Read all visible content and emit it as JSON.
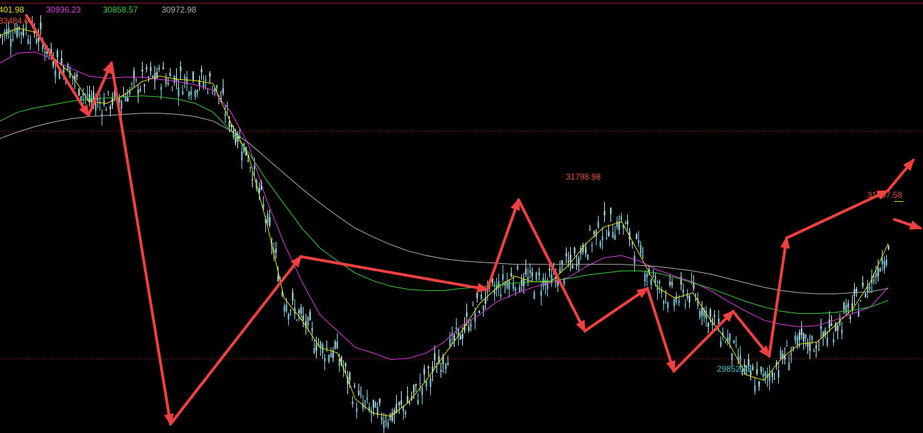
{
  "chart_data": {
    "type": "line",
    "title": "",
    "legend": [
      {
        "text": "401.98",
        "color": "#e6e600"
      },
      {
        "text": "30936.23",
        "color": "#e040e0"
      },
      {
        "text": "30858.57",
        "color": "#40d040"
      },
      {
        "text": "30972.98",
        "color": "#b0b0b0"
      }
    ],
    "ylim": [
      29700,
      33600
    ],
    "reference_lines": [
      33600,
      32430,
      30350
    ],
    "annotations": [
      {
        "text": "33484.08",
        "color": "#e85040",
        "value": 33484.08,
        "position": "top-left"
      },
      {
        "text": "31798.98",
        "color": "#e85040",
        "value": 31798.98
      },
      {
        "text": "31607.58",
        "color": "#e85040",
        "value": 31607.58
      },
      {
        "text": "29852.42",
        "color": "#40c0d0",
        "value": 29852.42
      }
    ],
    "trend_arrows": [
      {
        "from": 33484,
        "to": 32570
      },
      {
        "from": 32570,
        "to": 33050
      },
      {
        "from": 33050,
        "to": 29750
      },
      {
        "from": 29750,
        "to": 31280
      },
      {
        "from": 31280,
        "to": 30980
      },
      {
        "from": 30980,
        "to": 31799
      },
      {
        "from": 31799,
        "to": 30600
      },
      {
        "from": 30600,
        "to": 30990
      },
      {
        "from": 30990,
        "to": 30233
      },
      {
        "from": 30233,
        "to": 30780
      },
      {
        "from": 30780,
        "to": 30370
      },
      {
        "from": 30370,
        "to": 31450
      },
      {
        "from": 31450,
        "to": 31880
      },
      {
        "from": 31620,
        "to": 31540
      }
    ],
    "series": [
      {
        "color": "#e6e600",
        "values": [
          33300,
          33370,
          33330,
          33100,
          32950,
          32700,
          32680,
          32760,
          32880,
          32930,
          32900,
          32890,
          32860,
          32500,
          32200,
          31600,
          30900,
          30700,
          30450,
          30400,
          29980,
          29850,
          29820,
          29950,
          30150,
          30380,
          30600,
          30850,
          31000,
          31100,
          31050,
          31050,
          31200,
          31400,
          31550,
          31600,
          31300,
          31000,
          30900,
          30950,
          30700,
          30500,
          30200,
          30150,
          30350,
          30480,
          30500,
          30650,
          30800,
          31050,
          31400
        ]
      },
      {
        "color": "#e040e0",
        "values": [
          33050,
          33140,
          33150,
          33080,
          33000,
          32930,
          32910,
          32920,
          32920,
          32900,
          32880,
          32850,
          32800,
          32600,
          32300,
          31800,
          31400,
          31050,
          30750,
          30600,
          30450,
          30400,
          30340,
          30350,
          30400,
          30500,
          30650,
          30750,
          30870,
          30940,
          31000,
          31040,
          31090,
          31190,
          31270,
          31290,
          31240,
          31160,
          31100,
          31050,
          30970,
          30870,
          30780,
          30700,
          30660,
          30640,
          30650,
          30700,
          30760,
          30820,
          31000
        ]
      },
      {
        "color": "#40d040",
        "values": [
          32520,
          32600,
          32640,
          32670,
          32700,
          32720,
          32730,
          32740,
          32750,
          32740,
          32720,
          32680,
          32600,
          32430,
          32230,
          31980,
          31760,
          31540,
          31360,
          31240,
          31130,
          31060,
          31010,
          30980,
          30970,
          30970,
          30990,
          31000,
          31020,
          31040,
          31050,
          31060,
          31080,
          31110,
          31130,
          31150,
          31150,
          31130,
          31090,
          31040,
          30990,
          30930,
          30870,
          30820,
          30780,
          30760,
          30760,
          30770,
          30790,
          30820,
          30880
        ]
      },
      {
        "color": "#b0b0b0",
        "values": [
          32360,
          32420,
          32470,
          32510,
          32540,
          32560,
          32570,
          32580,
          32590,
          32590,
          32580,
          32560,
          32520,
          32430,
          32320,
          32180,
          32040,
          31900,
          31770,
          31650,
          31540,
          31460,
          31390,
          31330,
          31290,
          31260,
          31240,
          31230,
          31220,
          31210,
          31210,
          31210,
          31210,
          31210,
          31210,
          31210,
          31200,
          31190,
          31170,
          31150,
          31120,
          31080,
          31040,
          31000,
          30970,
          30950,
          30940,
          30940,
          30950,
          30960,
          30990
        ]
      }
    ]
  }
}
